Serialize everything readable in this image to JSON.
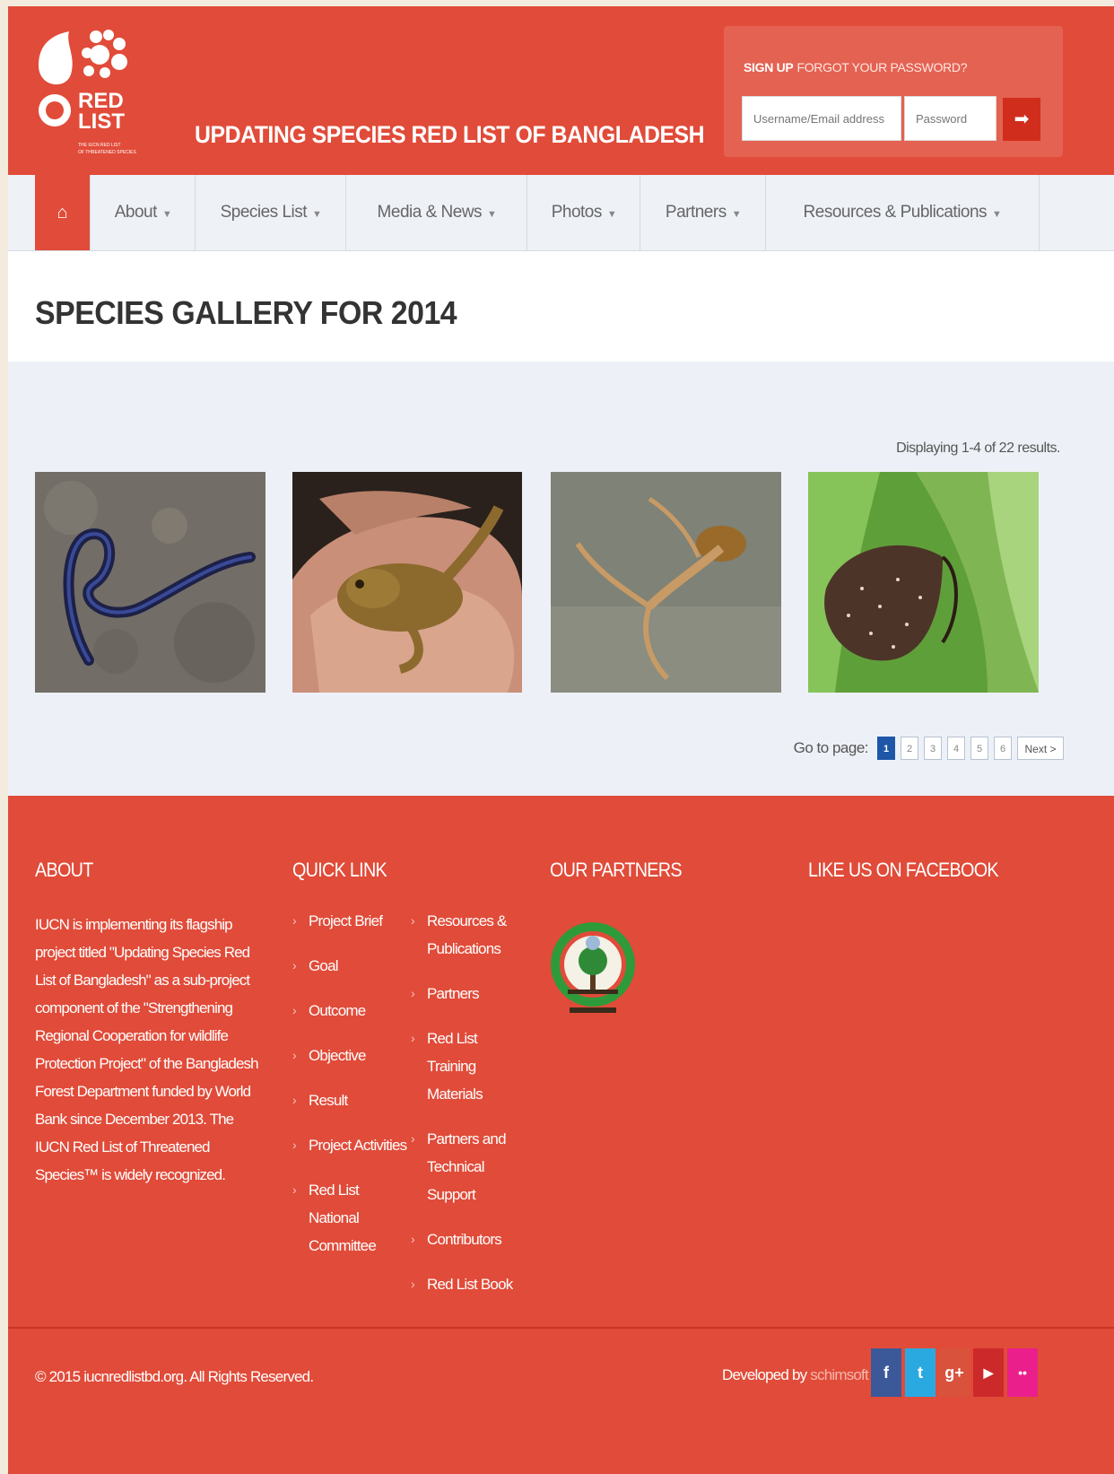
{
  "header": {
    "site_title": "UPDATING SPECIES RED LIST OF BANGLADESH",
    "logo_text": [
      "RED",
      "LIST",
      "THE IUCN RED LIST",
      "OF THREATENED SPECIES"
    ],
    "login": {
      "signup_label": "SIGN UP",
      "forgot_label": "FORGOT YOUR PASSWORD?",
      "username_placeholder": "Username/Email address",
      "password_placeholder": "Password",
      "submit_icon": "arrow-right-icon"
    }
  },
  "nav": {
    "home_icon": "home-icon",
    "items": [
      {
        "label": "About"
      },
      {
        "label": "Species List"
      },
      {
        "label": "Media & News"
      },
      {
        "label": "Photos"
      },
      {
        "label": "Partners"
      },
      {
        "label": "Resources & Publications"
      }
    ]
  },
  "page": {
    "title": "SPECIES GALLERY FOR 2014",
    "summary": "Displaying 1-4 of 22 results."
  },
  "gallery": {
    "images": [
      {
        "subject": "worm"
      },
      {
        "subject": "frog-in-hand"
      },
      {
        "subject": "frog-on-water"
      },
      {
        "subject": "butterfly"
      }
    ]
  },
  "pager": {
    "label": "Go to page:",
    "pages": [
      "1",
      "2",
      "3",
      "4",
      "5",
      "6"
    ],
    "current": "1",
    "next": "Next >"
  },
  "footer": {
    "about": {
      "heading": "ABOUT",
      "text": "IUCN is implementing its flagship project titled \"Updating Species Red List of Bangladesh\" as a sub-project component of the \"Strengthening Regional Cooperation for wildlife Protection Project\" of the Bangladesh Forest Department funded by World Bank since December 2013. The IUCN Red List of Threatened Species™ is widely recognized."
    },
    "quick_link": {
      "heading": "QUICK LINK",
      "col1": [
        "Project Brief",
        "Goal",
        "Outcome",
        "Objective",
        "Result",
        "Project Activities",
        "Red List National Committee"
      ],
      "col2": [
        "Resources & Publications",
        "Partners",
        "Red List Training Materials",
        "Partners and Technical Support",
        "Contributors",
        "Red List Book"
      ]
    },
    "partners": {
      "heading": "OUR PARTNERS"
    },
    "facebook": {
      "heading": "LIKE US ON FACEBOOK"
    },
    "copyright": "© 2015 iucnredlistbd.org. All Rights Reserved.",
    "developed_by": "Developed by",
    "developer": "schimsoft",
    "social": [
      {
        "icon": "facebook-icon",
        "glyph": "f",
        "color": "#3b5998"
      },
      {
        "icon": "twitter-icon",
        "glyph": "t",
        "color": "#2aa9e0"
      },
      {
        "icon": "google-plus-icon",
        "glyph": "g+",
        "color": "#d8523c"
      },
      {
        "icon": "youtube-icon",
        "glyph": "▶",
        "color": "#cc2a2a"
      },
      {
        "icon": "flickr-icon",
        "glyph": "••",
        "color": "#ea1f8c"
      }
    ]
  }
}
